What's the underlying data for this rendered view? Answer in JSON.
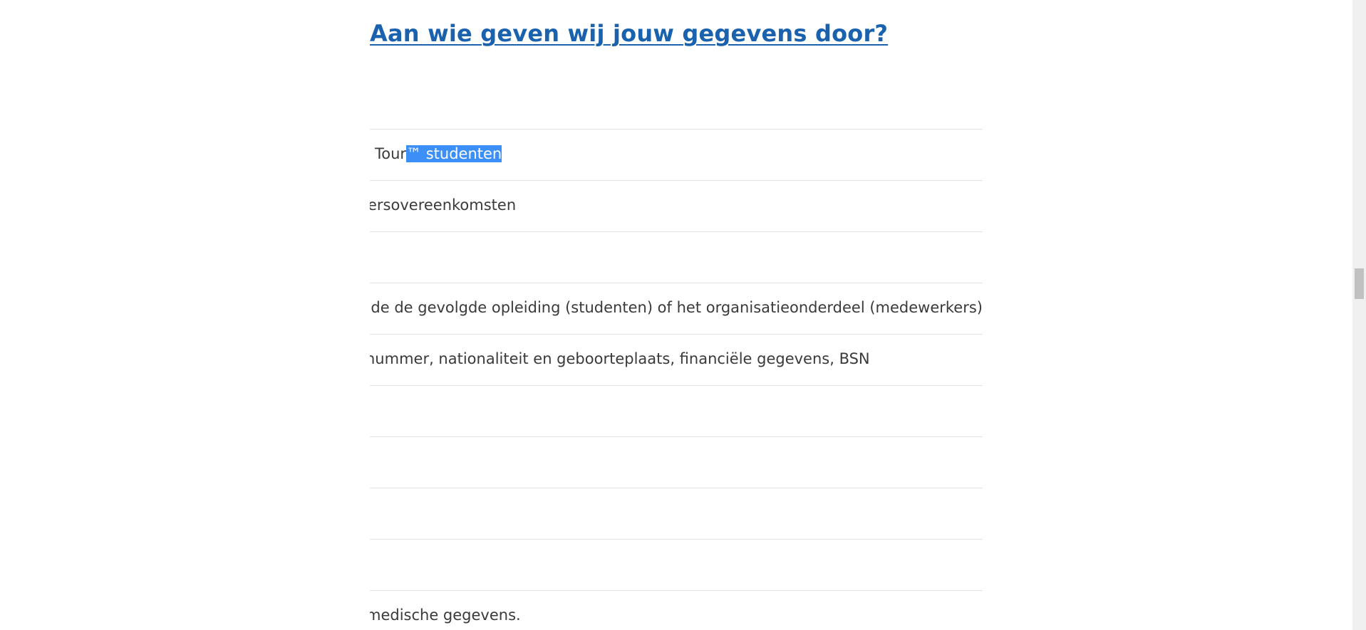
{
  "page": {
    "heading": "Aan wie geven wij jouw gegevens door?"
  },
  "table": {
    "rows": [
      {
        "text_before": "Tour",
        "text_selected": "™ studenten"
      },
      {
        "text": "ersovereenkomsten"
      },
      {
        "text": ""
      },
      {
        "text": "ende de gevolgde opleiding (studenten) of het organisatieonderdeel (medewerkers)"
      },
      {
        "text": "nummer, nationaliteit en geboorteplaats, financiële gegevens, BSN"
      },
      {
        "text": ""
      },
      {
        "text": ""
      },
      {
        "text": ""
      },
      {
        "text": ""
      },
      {
        "text": "medische gegevens."
      }
    ]
  },
  "colors": {
    "heading": "#1a62ad",
    "selection": "#3b8ff7",
    "divider": "#e3e3e3"
  }
}
